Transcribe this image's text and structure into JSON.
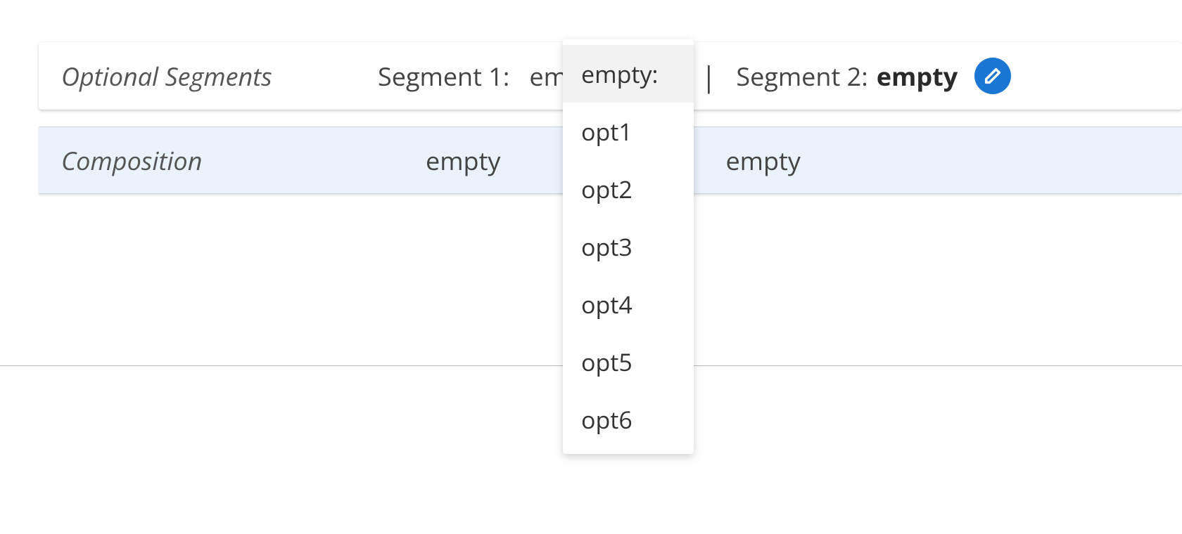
{
  "optional_segments": {
    "title": "Optional Segments",
    "segment1": {
      "label": "Segment 1:",
      "value": "empty:"
    },
    "separator": "|",
    "segment2": {
      "label": "Segment 2:",
      "value": "empty"
    },
    "dropdown": {
      "selected": "empty:",
      "options": [
        "empty:",
        "opt1",
        "opt2",
        "opt3",
        "opt4",
        "opt5",
        "opt6"
      ]
    }
  },
  "composition": {
    "title": "Composition",
    "col1": "empty",
    "col2": "empty"
  },
  "colors": {
    "accent": "#1976d2",
    "row_alt_bg": "#eaf2fb"
  },
  "icons": {
    "confirm": "check-icon",
    "edit": "pencil-icon"
  }
}
